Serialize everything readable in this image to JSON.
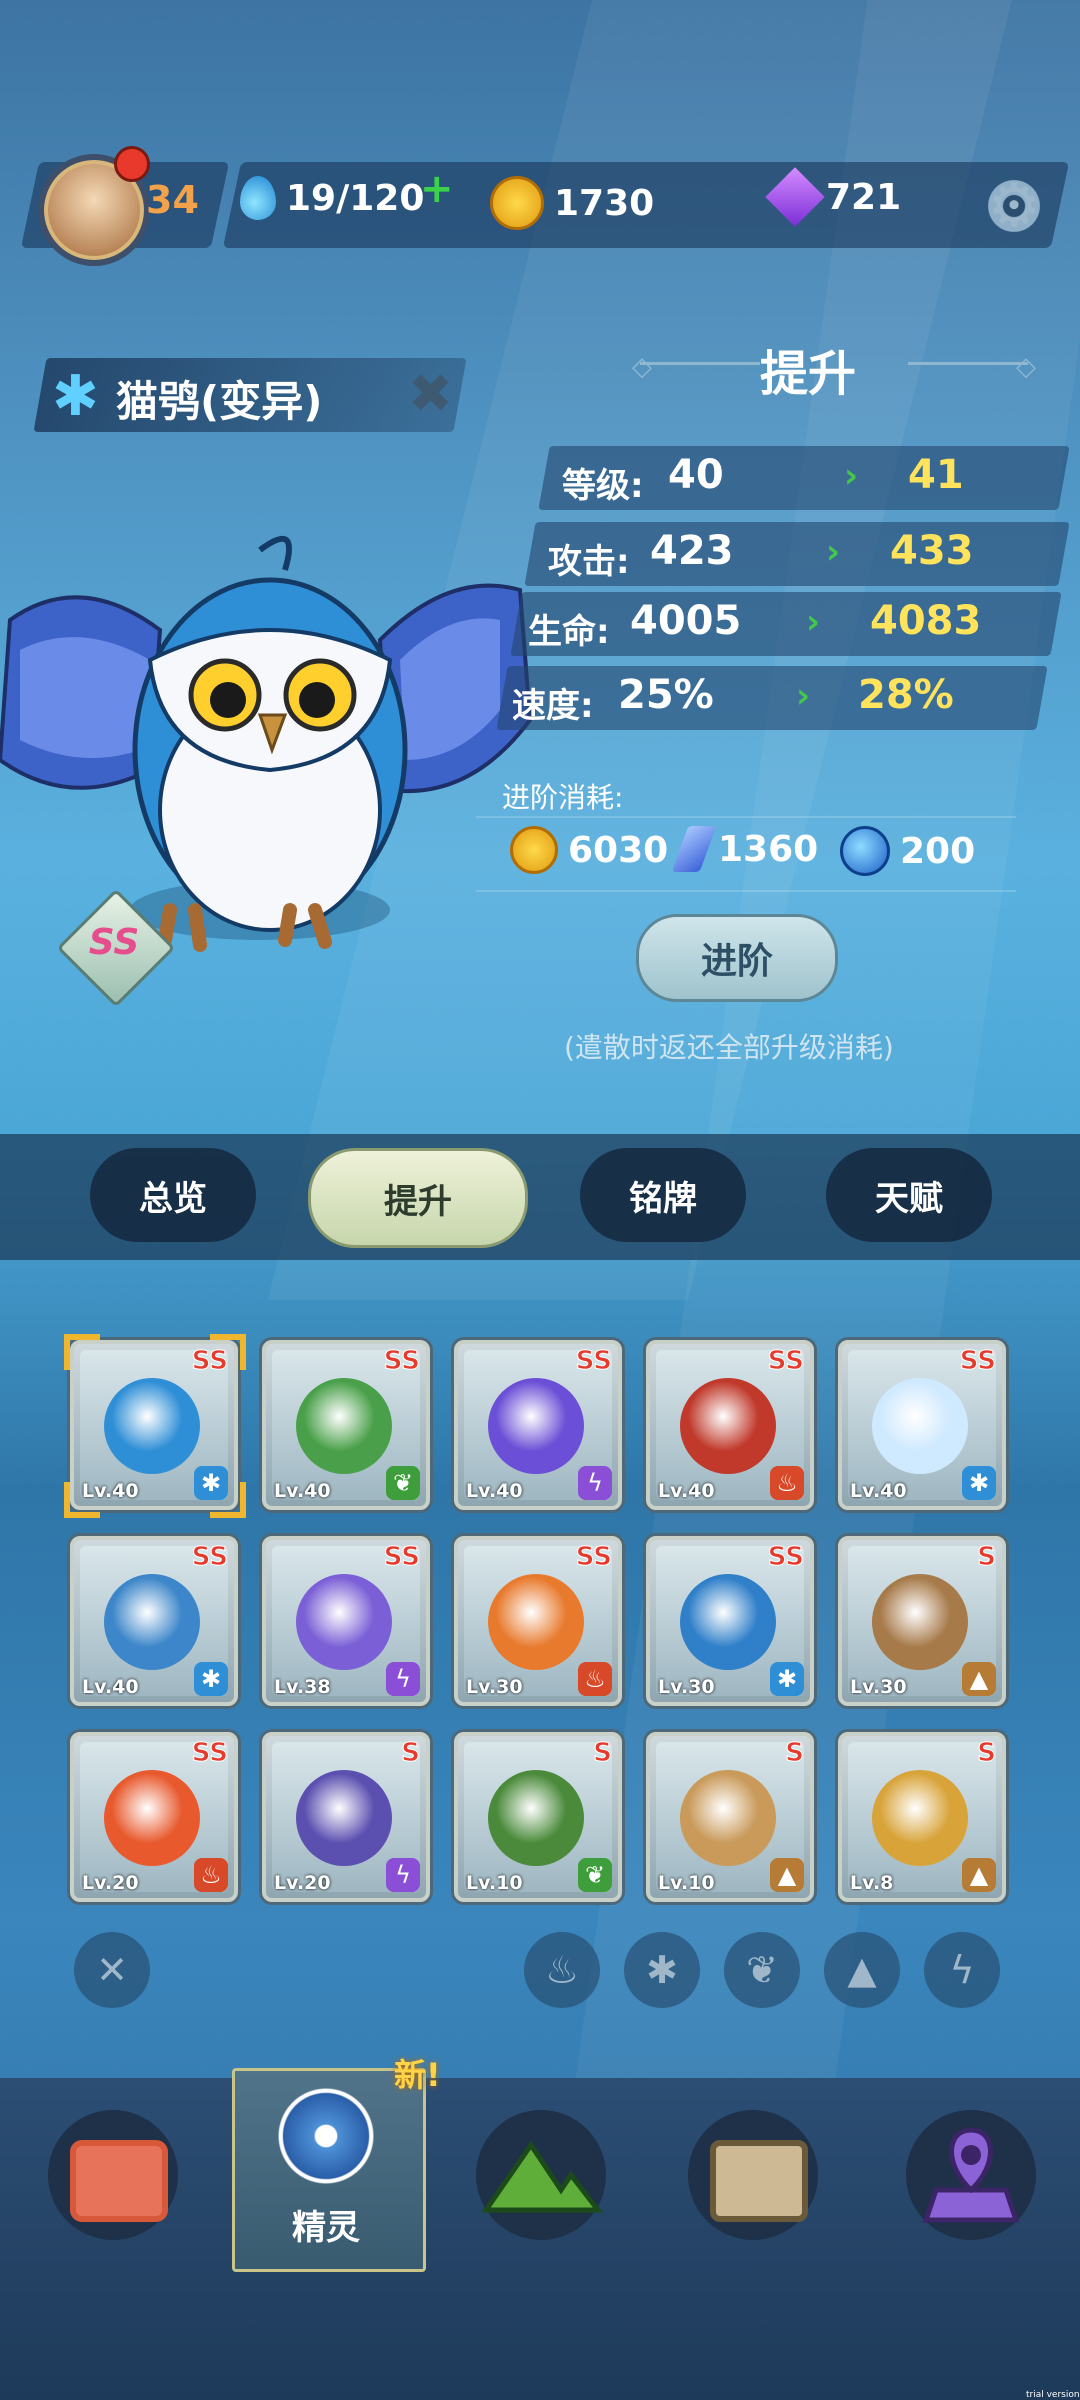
{
  "top_bar": {
    "player_level": "34",
    "stamina": "19/120",
    "stamina_plus": "+",
    "coins": "1730",
    "gems": "721"
  },
  "spirit": {
    "name": "猫鸮(变异)",
    "grade": "SS"
  },
  "upgrade": {
    "title": "提升",
    "stats": [
      {
        "label": "等级:",
        "current": "40",
        "next": "41"
      },
      {
        "label": "攻击:",
        "current": "423",
        "next": "433"
      },
      {
        "label": "生命:",
        "current": "4005",
        "next": "4083"
      },
      {
        "label": "速度:",
        "current": "25%",
        "next": "28%"
      }
    ],
    "cost_label": "进阶消耗:",
    "costs": {
      "coins": "6030",
      "feathers": "1360",
      "orbs": "200"
    },
    "advance_button": "进阶",
    "note": "(遣散时返还全部升级消耗)"
  },
  "tabs": [
    "总览",
    "提升",
    "铭牌",
    "天赋"
  ],
  "active_tab": "提升",
  "spirits": [
    {
      "grade": "SS",
      "level": "Lv.40",
      "element": "ice"
    },
    {
      "grade": "SS",
      "level": "Lv.40",
      "element": "leaf"
    },
    {
      "grade": "SS",
      "level": "Lv.40",
      "element": "lightning"
    },
    {
      "grade": "SS",
      "level": "Lv.40",
      "element": "fire"
    },
    {
      "grade": "SS",
      "level": "Lv.40",
      "element": "ice"
    },
    {
      "grade": "SS",
      "level": "Lv.40",
      "element": "ice"
    },
    {
      "grade": "SS",
      "level": "Lv.38",
      "element": "lightning"
    },
    {
      "grade": "SS",
      "level": "Lv.30",
      "element": "fire"
    },
    {
      "grade": "SS",
      "level": "Lv.30",
      "element": "ice"
    },
    {
      "grade": "S",
      "level": "Lv.30",
      "element": "earth"
    },
    {
      "grade": "SS",
      "level": "Lv.20",
      "element": "fire"
    },
    {
      "grade": "S",
      "level": "Lv.20",
      "element": "lightning"
    },
    {
      "grade": "S",
      "level": "Lv.10",
      "element": "leaf"
    },
    {
      "grade": "S",
      "level": "Lv.10",
      "element": "earth"
    },
    {
      "grade": "S",
      "level": "Lv.8",
      "element": "earth"
    }
  ],
  "filters": [
    "clear-filter-icon",
    "fire-filter-icon",
    "ice-filter-icon",
    "leaf-filter-icon",
    "earth-filter-icon",
    "lightning-filter-icon"
  ],
  "bottom_nav": {
    "items": [
      "home-icon",
      "spirit-icon",
      "mountain-icon",
      "chest-icon",
      "map-pin-icon"
    ],
    "active_label": "精灵",
    "new_badge": "新!"
  },
  "watermark": "trial version",
  "colors": {
    "ice": "#2f8fd6",
    "leaf": "#3e9e3c",
    "lightning": "#8a4fd6",
    "fire": "#d8492a",
    "earth": "#b67b34",
    "accent_yellow": "#ffe35c"
  }
}
